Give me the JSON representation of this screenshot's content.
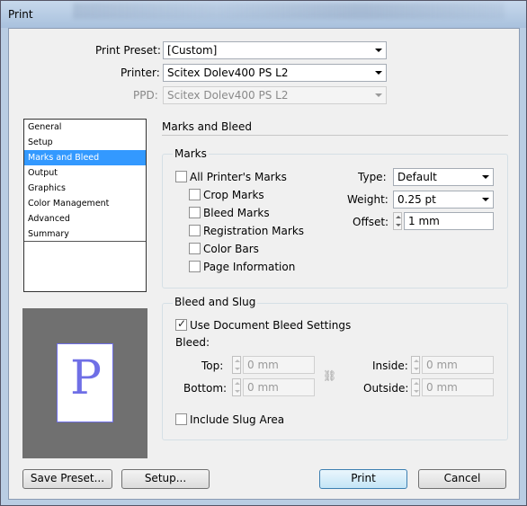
{
  "window": {
    "title": "Print"
  },
  "top": {
    "print_preset_label": "Print Preset:",
    "print_preset_value": "[Custom]",
    "printer_label": "Printer:",
    "printer_value": "Scitex Dolev400 PS L2",
    "ppd_label": "PPD:",
    "ppd_value": "Scitex Dolev400 PS L2"
  },
  "categories": [
    "General",
    "Setup",
    "Marks and Bleed",
    "Output",
    "Graphics",
    "Color Management",
    "Advanced",
    "Summary"
  ],
  "selected_category": "Marks and Bleed",
  "section": {
    "title": "Marks and Bleed"
  },
  "marks": {
    "group_title": "Marks",
    "all_printers_marks": "All Printer's Marks",
    "crop_marks": "Crop Marks",
    "bleed_marks": "Bleed Marks",
    "registration_marks": "Registration Marks",
    "color_bars": "Color Bars",
    "page_information": "Page Information",
    "type_label": "Type:",
    "type_value": "Default",
    "weight_label": "Weight:",
    "weight_value": "0.25 pt",
    "offset_label": "Offset:",
    "offset_value": "1 mm"
  },
  "bleed_slug": {
    "group_title": "Bleed and Slug",
    "use_document_bleed": "Use Document Bleed Settings",
    "bleed_label": "Bleed:",
    "top_label": "Top:",
    "top_value": "0 mm",
    "bottom_label": "Bottom:",
    "bottom_value": "0 mm",
    "inside_label": "Inside:",
    "inside_value": "0 mm",
    "outside_label": "Outside:",
    "outside_value": "0 mm",
    "include_slug_area": "Include Slug Area"
  },
  "preview": {
    "letter": "P"
  },
  "buttons": {
    "save_preset": "Save Preset...",
    "setup": "Setup...",
    "print": "Print",
    "cancel": "Cancel"
  },
  "colors": {
    "selection": "#3399ff",
    "preview_bg": "#707070",
    "preview_glyph": "#6f6fe6"
  }
}
